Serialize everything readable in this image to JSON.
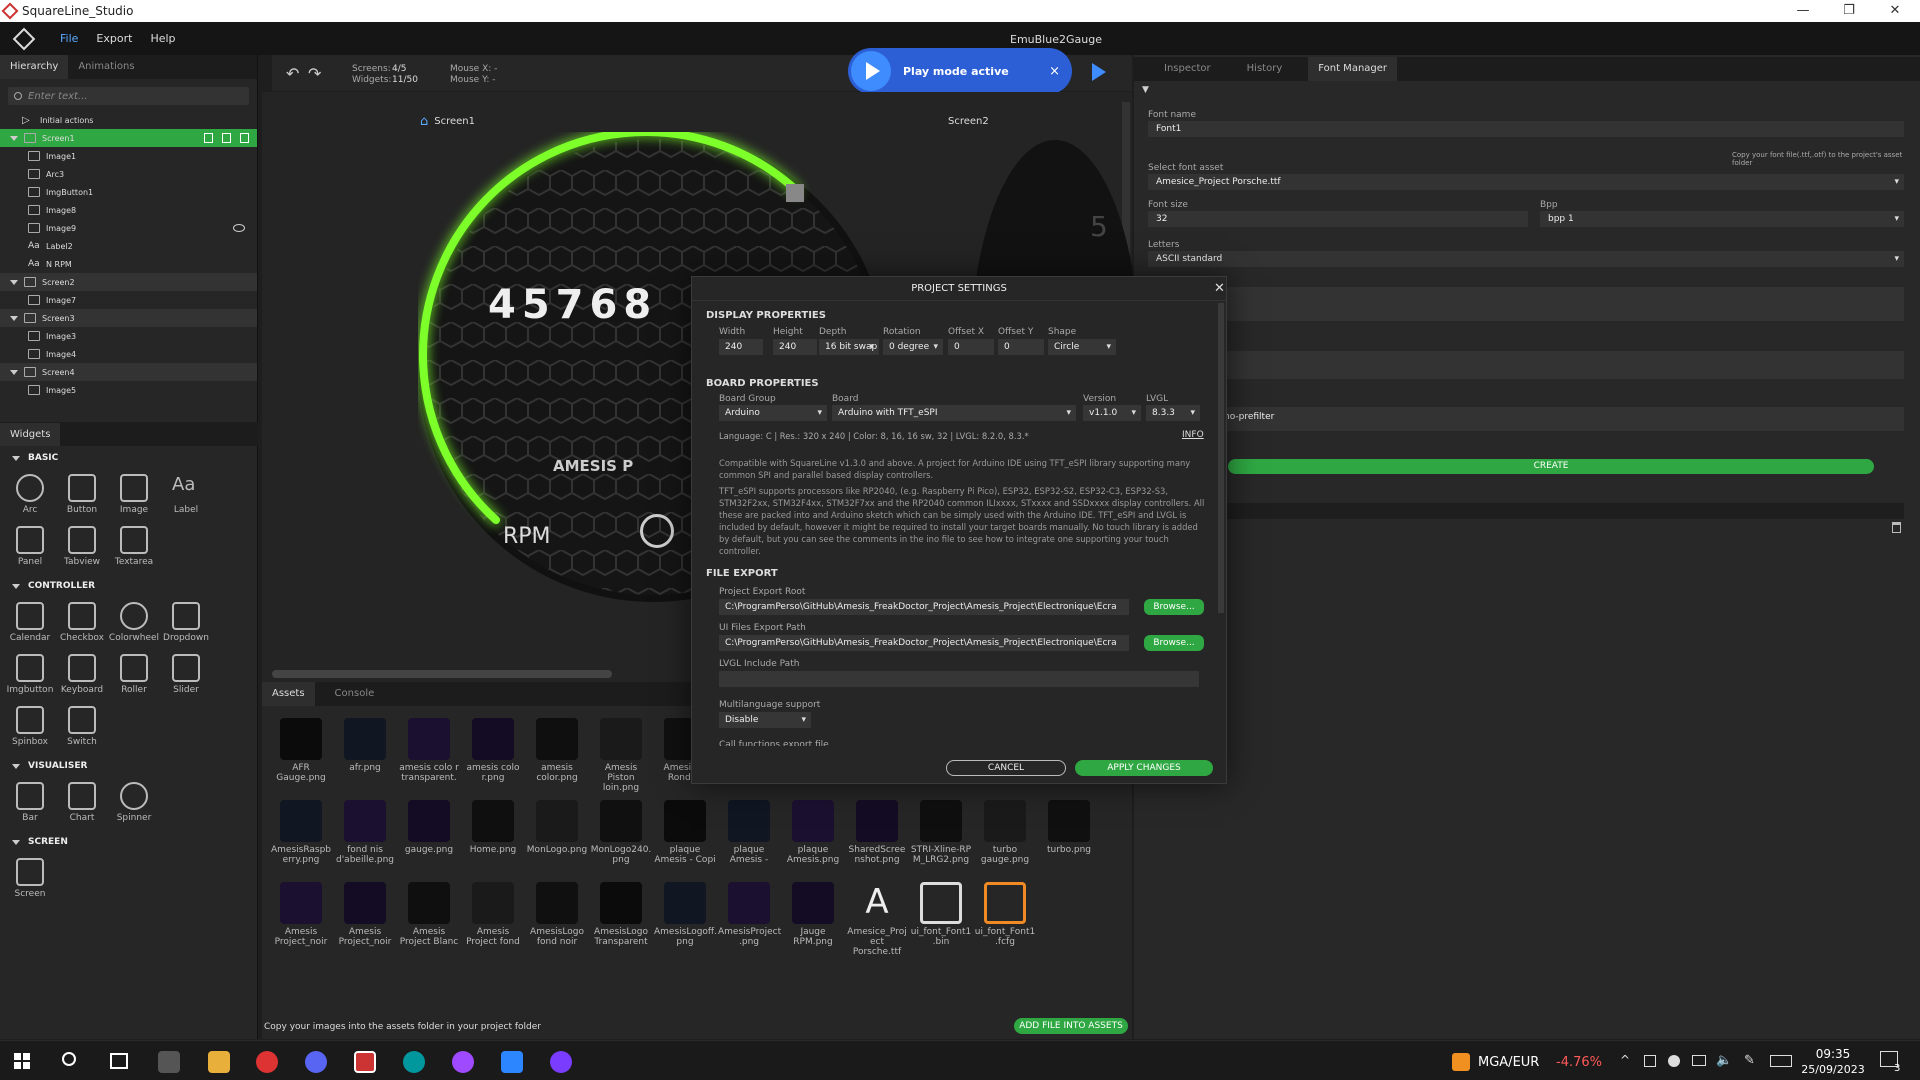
{
  "window": {
    "title": "SquareLine_Studio",
    "project": "EmuBlue2Gauge",
    "controls": [
      "—",
      "❐",
      "✕"
    ]
  },
  "menu": {
    "items": [
      "File",
      "Export",
      "Help"
    ]
  },
  "hierarchy": {
    "tabs": [
      "Hierarchy",
      "Animations"
    ],
    "search_placeholder": "Enter text...",
    "rows": [
      {
        "label": "Initial actions",
        "indent": 1,
        "type": "action"
      },
      {
        "label": "Screen1",
        "indent": 0,
        "type": "screen",
        "selected": true
      },
      {
        "label": "Image1",
        "indent": 2,
        "type": "image"
      },
      {
        "label": "Arc3",
        "indent": 2,
        "type": "arc"
      },
      {
        "label": "ImgButton1",
        "indent": 2,
        "type": "imgbutton"
      },
      {
        "label": "Image8",
        "indent": 2,
        "type": "image"
      },
      {
        "label": "Image9",
        "indent": 2,
        "type": "image",
        "hidden": true
      },
      {
        "label": "Label2",
        "indent": 2,
        "type": "label"
      },
      {
        "label": "N RPM",
        "indent": 2,
        "type": "label"
      },
      {
        "label": "Screen2",
        "indent": 0,
        "type": "screen"
      },
      {
        "label": "Image7",
        "indent": 2,
        "type": "image"
      },
      {
        "label": "Screen3",
        "indent": 0,
        "type": "screen"
      },
      {
        "label": "Image3",
        "indent": 2,
        "type": "image"
      },
      {
        "label": "Image4",
        "indent": 2,
        "type": "image"
      },
      {
        "label": "Screen4",
        "indent": 0,
        "type": "screen"
      },
      {
        "label": "Image5",
        "indent": 2,
        "type": "image"
      }
    ]
  },
  "widgets": {
    "tab": "Widgets",
    "sections": [
      {
        "title": "BASIC",
        "items": [
          "Arc",
          "Button",
          "Image",
          "Label",
          "Panel",
          "Tabview",
          "Textarea"
        ]
      },
      {
        "title": "CONTROLLER",
        "items": [
          "Calendar",
          "Checkbox",
          "Colorwheel",
          "Dropdown",
          "Imgbutton",
          "Keyboard",
          "Roller",
          "Slider",
          "Spinbox",
          "Switch"
        ]
      },
      {
        "title": "VISUALISER",
        "items": [
          "Bar",
          "Chart",
          "Spinner"
        ]
      },
      {
        "title": "SCREEN",
        "items": [
          "Screen"
        ]
      }
    ]
  },
  "toolbar": {
    "screens_label": "Screens:",
    "screens_value": "4/5",
    "widgets_label": "Widgets:",
    "widgets_value": "11/50",
    "mousex": "Mouse X:  -",
    "mousey": "Mouse Y:  -"
  },
  "play_banner": {
    "text": "Play mode active",
    "close": "×"
  },
  "canvas": {
    "screen1_tab": "Screen1",
    "screen2_tab": "Screen2",
    "rpm_value": "45768",
    "rpm_label": "RPM",
    "brand": "AMESIS P",
    "screen2_digit": "5"
  },
  "assets": {
    "tabs": [
      "Assets",
      "Console"
    ],
    "rows": [
      [
        "AFR Gauge.png",
        "afr.png",
        "amesis colo r transparent.",
        "amesis colo r.png",
        "amesis color.png",
        "Amesis Piston loin.png",
        "Amesis Pi Rond..p"
      ],
      [
        "AmesisRaspb erry.png",
        "fond nis d'abeille.png",
        "gauge.png",
        "Home.png",
        "MonLogo.png",
        "MonLogo240. png",
        "plaque Amesis - Copi",
        "plaque Amesis -",
        "plaque Amesis.png",
        "SharedScree nshot.png",
        "STRI-Xline-RP M_LRG2.png",
        "turbo gauge.png",
        "turbo.png"
      ],
      [
        "Amesis Project_noir",
        "Amesis Project_noir",
        "Amesis Project Blanc",
        "Amesis Project fond",
        "AmesisLogo fond noir",
        "AmesisLogo Transparent",
        "AmesisLogoff. png",
        "AmesisProject .png",
        "Jauge RPM.png",
        "Amesice_Proj ect Porsche.ttf",
        "ui_font_Font1 .bin",
        "ui_font_Font1 .fcfg"
      ]
    ],
    "hint": "Copy your images into the assets folder in your project folder",
    "add_button": "ADD FILE INTO ASSETS"
  },
  "right_panel": {
    "tabs": [
      "Inspector",
      "History",
      "Font Manager"
    ],
    "font_name_label": "Font name",
    "font_name": "Font1",
    "copy_hint": "Copy your font file(.ttf,.otf) to the project's asset folder",
    "select_asset_label": "Select font asset",
    "font_asset": "Amesice_Project Porsche.ttf",
    "font_size_label": "Font size",
    "font_size": "32",
    "bpp_label": "Bpp",
    "bpp": "bpp 1",
    "letters_label": "Letters",
    "letters": "ASCII standard",
    "prefilter": "no-prefilter",
    "create_button": "CREATE"
  },
  "project_settings": {
    "title": "PROJECT SETTINGS",
    "display_title": "DISPLAY PROPERTIES",
    "display": [
      {
        "label": "Width",
        "value": "240"
      },
      {
        "label": "Height",
        "value": "240"
      },
      {
        "label": "Depth",
        "value": "16 bit swap"
      },
      {
        "label": "Rotation",
        "value": "0 degree"
      },
      {
        "label": "Offset X",
        "value": "0"
      },
      {
        "label": "Offset Y",
        "value": "0"
      },
      {
        "label": "Shape",
        "value": "Circle"
      }
    ],
    "board_title": "BOARD PROPERTIES",
    "board_group_label": "Board Group",
    "board_group": "Arduino",
    "board_label": "Board",
    "board": "Arduino with TFT_eSPI",
    "version_label": "Version",
    "version": "v1.1.0",
    "lvgl_label": "LVGL",
    "lvgl": "8.3.3",
    "spec_line": "Language: C | Res.: 320 x 240 | Color: 8, 16, 16 sw, 32 | LVGL: 8.2.0, 8.3.*",
    "info_link": "INFO",
    "desc1": "Compatible with SquareLine v1.3.0 and above. A project for Arduino IDE using TFT_eSPI library supporting many common SPI and parallel based display controllers.",
    "desc2": "TFT_eSPI supports processors like RP2040, (e.g. Raspberry Pi Pico), ESP32, ESP32-S2, ESP32-C3, ESP32-S3, STM32F2xx, STM32F4xx, STM32F7xx and the RP2040 common ILIxxxx, STxxxx and SSDxxxx display controllers. All these are packed into and Arduino sketch which can be simply used with the Arduino IDE. TFT_eSPI and LVGL is included by default, however it might be required to install your target boards manually. No touch library is added by default, but you can see the comments in the ino file to see how to integrate one supporting your touch controller.",
    "export_title": "FILE EXPORT",
    "export_root_label": "Project Export Root",
    "export_root": "C:\\ProgramPerso\\GitHub\\Amesis_FreakDoctor_Project\\Amesis_Project\\Electronique\\Ecra",
    "ui_path_label": "UI Files Export Path",
    "ui_path": "C:\\ProgramPerso\\GitHub\\Amesis_FreakDoctor_Project\\Amesis_Project\\Electronique\\Ecra",
    "browse": "Browse...",
    "lvgl_include_label": "LVGL Include Path",
    "multilang_label": "Multilanguage support",
    "multilang": "Disable",
    "call_functions_label": "Call functions export file",
    "cancel": "CANCEL",
    "apply": "APPLY CHANGES"
  },
  "taskbar": {
    "currency": "MGA/EUR",
    "change": "-4.76%",
    "time": "09:35",
    "date": "25/09/2023",
    "notif": "3"
  },
  "colors": {
    "accent_green": "#2fa843",
    "play_blue": "#2c5fd6",
    "gauge_green": "#7dff2a"
  }
}
